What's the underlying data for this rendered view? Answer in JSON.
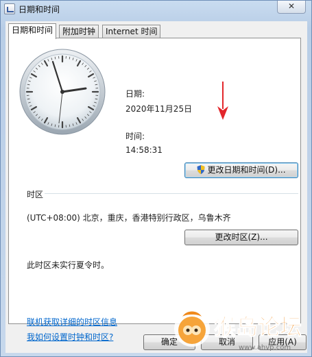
{
  "window": {
    "title": "日期和时间",
    "close_glyph": "✕"
  },
  "tabs": [
    {
      "label": "日期和时间",
      "active": true
    },
    {
      "label": "附加时钟",
      "active": false
    },
    {
      "label": "Internet 时间",
      "active": false
    }
  ],
  "datetime": {
    "date_label": "日期:",
    "date_value": "2020年11月25日",
    "time_label": "时间:",
    "time_value": "14:58:31",
    "change_button": "更改日期和时间(D)...",
    "change_button_icon": "uac-shield-icon"
  },
  "timezone": {
    "section_title": "时区",
    "value": "(UTC+08:00) 北京，重庆，香港特别行政区，乌鲁木齐",
    "change_button": "更改时区(Z)...",
    "dst_note": "此时区未实行夏令时。"
  },
  "links": [
    "联机获取详细的时区信息",
    "我如何设置时钟和时区?"
  ],
  "footer": {
    "ok": "确定",
    "cancel": "取消",
    "apply": "应用(A)"
  },
  "watermark": {
    "text": "猴岛论坛",
    "url": "www.ahvp.com"
  },
  "colors": {
    "link": "#0066cc",
    "annotation_arrow": "#e3262b",
    "watermark_orange": "#f08a1c"
  }
}
